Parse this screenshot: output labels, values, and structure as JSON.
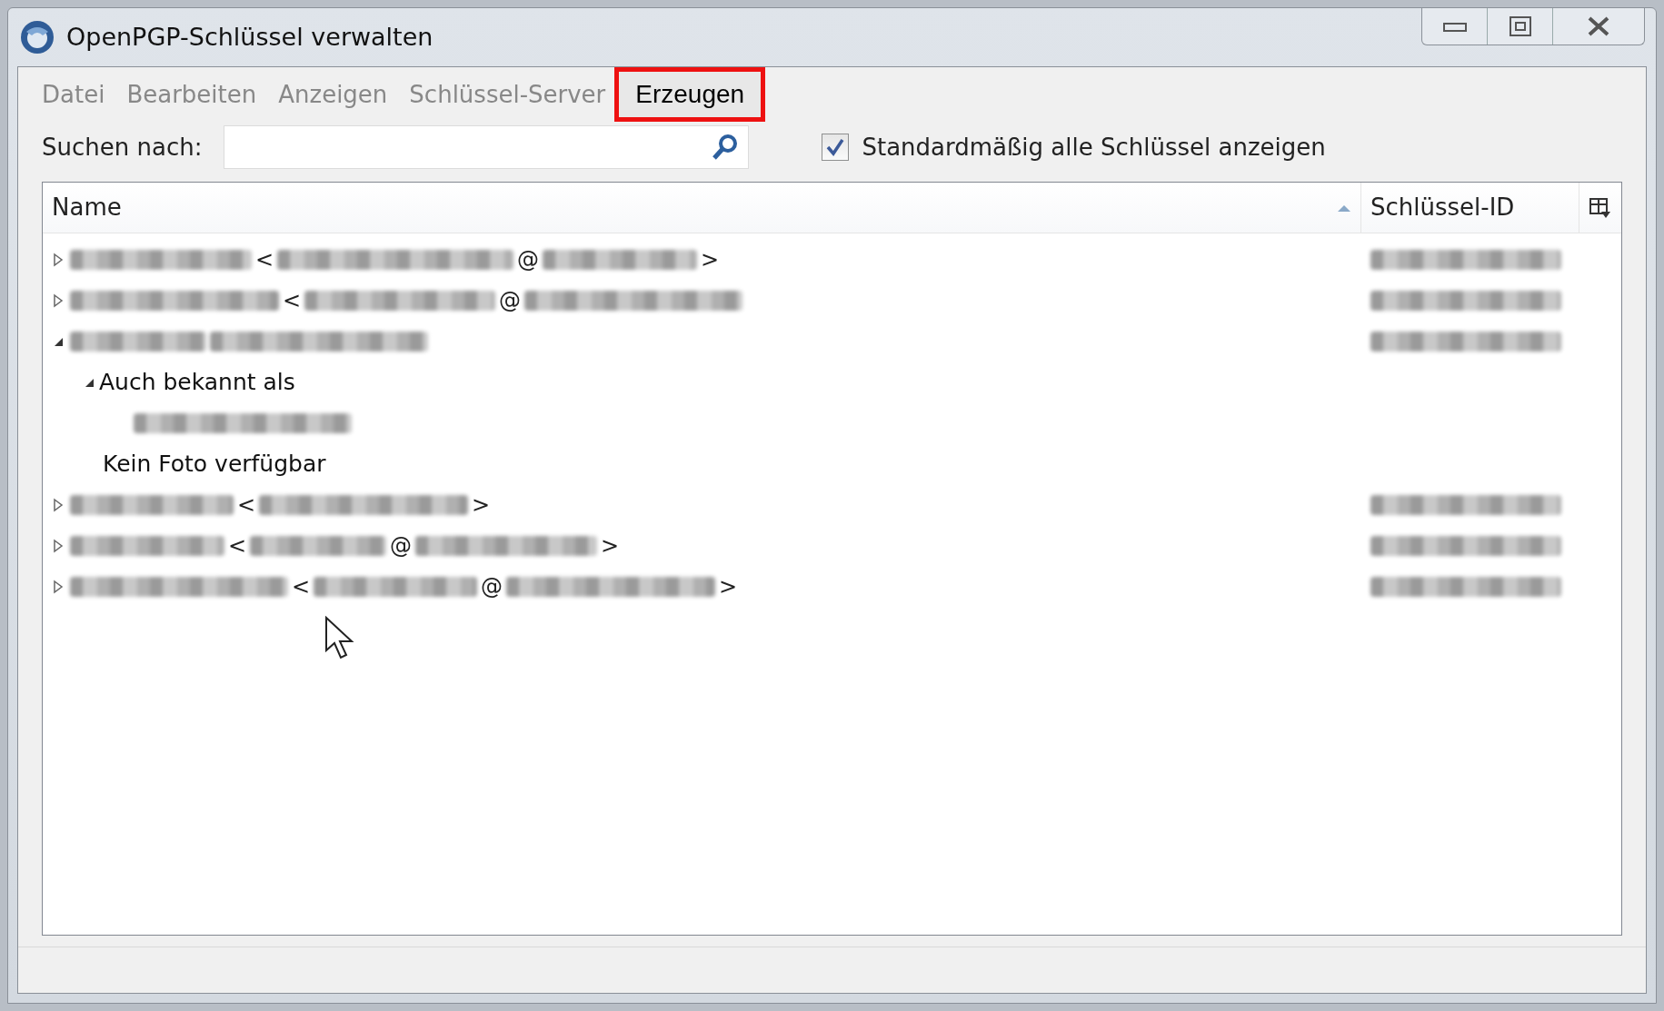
{
  "window": {
    "title": "OpenPGP-Schlüssel verwalten"
  },
  "menu": [
    {
      "label": "Datei",
      "highlighted": false
    },
    {
      "label": "Bearbeiten",
      "highlighted": false
    },
    {
      "label": "Anzeigen",
      "highlighted": false
    },
    {
      "label": "Schlüssel-Server",
      "highlighted": false
    },
    {
      "label": "Erzeugen",
      "highlighted": true
    }
  ],
  "search": {
    "label": "Suchen nach:"
  },
  "show_all": {
    "label": "Standardmäßig alle Schlüssel anzeigen",
    "checked": true
  },
  "table": {
    "columns": [
      {
        "label": "Name",
        "sorted": true
      },
      {
        "label": "Schlüssel-ID",
        "sorted": false
      }
    ],
    "rows": [
      {
        "expanded": false,
        "key_id": {
          "kind": "blur"
        },
        "parts": [
          {
            "kind": "blur"
          },
          {
            "kind": "text",
            "text": "<"
          },
          {
            "kind": "blur"
          },
          {
            "kind": "text",
            "text": "@"
          },
          {
            "kind": "blur"
          },
          {
            "kind": "text",
            "text": ">"
          }
        ]
      },
      {
        "expanded": false,
        "key_id": {
          "kind": "blur"
        },
        "parts": [
          {
            "kind": "blur"
          },
          {
            "kind": "text",
            "text": "<"
          },
          {
            "kind": "blur"
          },
          {
            "kind": "text",
            "text": "@"
          },
          {
            "kind": "blur"
          }
        ]
      },
      {
        "expanded": true,
        "key_id": {
          "kind": "blur"
        },
        "parts": [
          {
            "kind": "blur"
          },
          {
            "kind": "blur"
          }
        ],
        "children": [
          {
            "label": "Auch bekannt als",
            "expanded": true,
            "children": [
              {
                "parts": [
                  {
                    "kind": "blur"
                  }
                ]
              }
            ]
          },
          {
            "label": "Kein Foto verfügbar"
          }
        ]
      },
      {
        "expanded": false,
        "key_id": {
          "kind": "blur"
        },
        "parts": [
          {
            "kind": "blur"
          },
          {
            "kind": "text",
            "text": "<"
          },
          {
            "kind": "blur"
          },
          {
            "kind": "text",
            "text": ">"
          }
        ]
      },
      {
        "expanded": false,
        "key_id": {
          "kind": "blur"
        },
        "parts": [
          {
            "kind": "blur"
          },
          {
            "kind": "text",
            "text": "<"
          },
          {
            "kind": "blur"
          },
          {
            "kind": "text",
            "text": "@"
          },
          {
            "kind": "blur"
          },
          {
            "kind": "text",
            "text": ">"
          }
        ]
      },
      {
        "expanded": false,
        "key_id": {
          "kind": "blur"
        },
        "parts": [
          {
            "kind": "blur"
          },
          {
            "kind": "text",
            "text": "<"
          },
          {
            "kind": "blur"
          },
          {
            "kind": "text",
            "text": "@"
          },
          {
            "kind": "blur"
          },
          {
            "kind": "text",
            "text": ">"
          }
        ]
      }
    ]
  }
}
